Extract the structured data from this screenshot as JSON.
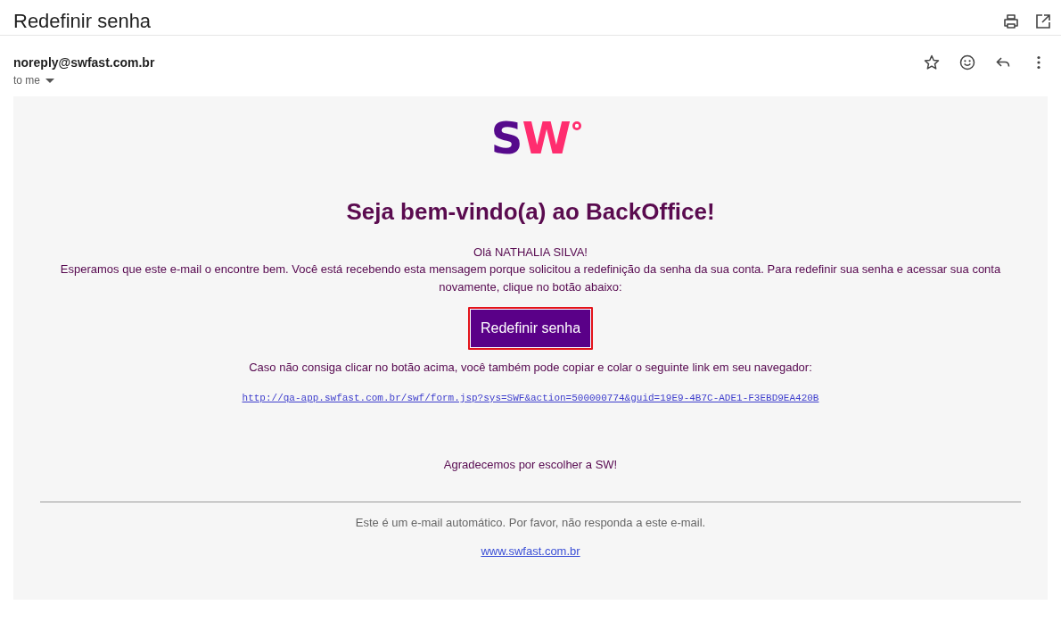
{
  "header": {
    "subject": "Redefinir senha"
  },
  "message": {
    "sender": "noreply@swfast.com.br",
    "recipient": "to me"
  },
  "email_body": {
    "logo": "SW",
    "heading": "Seja bem-vindo(a) ao BackOffice!",
    "greeting": "Olá NATHALIA SILVA!",
    "paragraph": "Esperamos que este e-mail o encontre bem. Você está recebendo esta mensagem porque solicitou a redefinição da senha da sua conta. Para redefinir sua senha e acessar sua conta novamente, clique no botão abaixo:",
    "button": "Redefinir senha",
    "fallback_text": "Caso não consiga clicar no botão acima, você também pode copiar e colar o seguinte link em seu navegador:",
    "reset_link": "http://qa-app.swfast.com.br/swf/form.jsp?sys=SWF&action=500000774&guid=19E9-4B7C-ADE1-F3EBD9EA420B",
    "thanks": "Agradecemos por escolher a SW!",
    "footer_note": "Este é um e-mail automático. Por favor, não responda a este e-mail.",
    "website_link": "www.swfast.com.br"
  }
}
